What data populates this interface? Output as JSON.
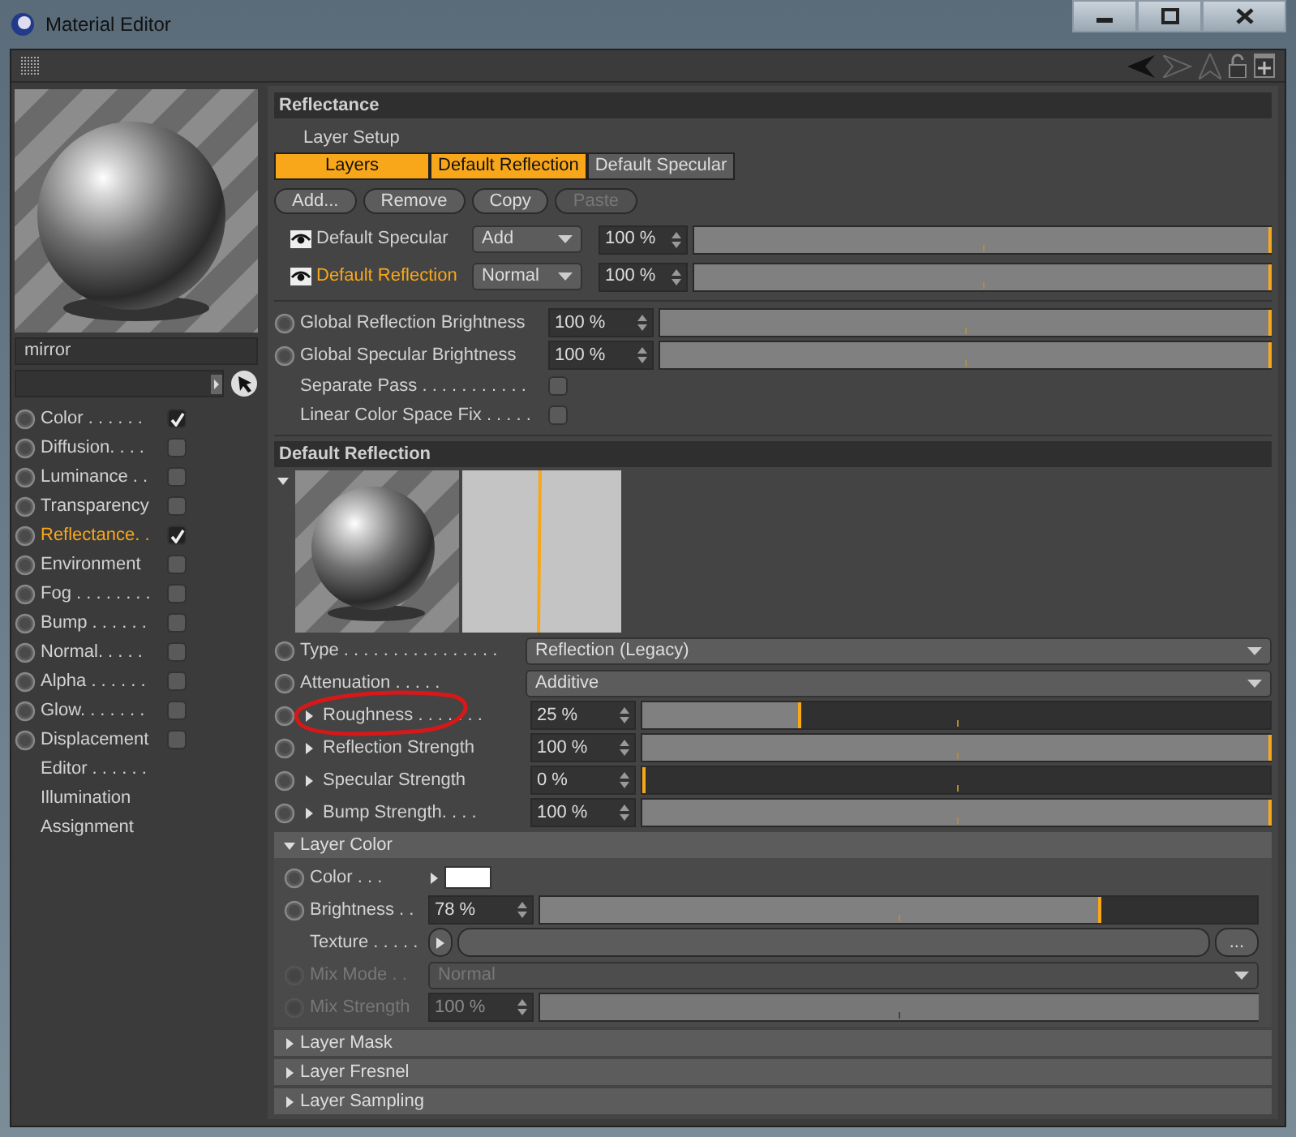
{
  "window": {
    "title": "Material Editor"
  },
  "material": {
    "name": "mirror"
  },
  "channels": [
    {
      "label": "Color . . . . . .",
      "kind": "channel",
      "checked": true,
      "selected": false
    },
    {
      "label": "Diffusion. . . .",
      "kind": "channel",
      "checked": false,
      "selected": false
    },
    {
      "label": "Luminance . .",
      "kind": "channel",
      "checked": false,
      "selected": false
    },
    {
      "label": "Transparency",
      "kind": "channel",
      "checked": false,
      "selected": false
    },
    {
      "label": "Reflectance. .",
      "kind": "channel",
      "checked": true,
      "selected": true
    },
    {
      "label": "Environment",
      "kind": "channel",
      "checked": false,
      "selected": false
    },
    {
      "label": "Fog . . . . . . . .",
      "kind": "channel",
      "checked": false,
      "selected": false
    },
    {
      "label": "Bump . . . . . .",
      "kind": "channel",
      "checked": false,
      "selected": false
    },
    {
      "label": "Normal. . . . .",
      "kind": "channel",
      "checked": false,
      "selected": false
    },
    {
      "label": "Alpha . . . . . .",
      "kind": "channel",
      "checked": false,
      "selected": false
    },
    {
      "label": "Glow. . . . . . .",
      "kind": "channel",
      "checked": false,
      "selected": false
    },
    {
      "label": "Displacement",
      "kind": "channel",
      "checked": false,
      "selected": false
    },
    {
      "label": "Editor . . . . . .",
      "kind": "page",
      "selected": false
    },
    {
      "label": "Illumination",
      "kind": "page",
      "selected": false
    },
    {
      "label": "Assignment",
      "kind": "page",
      "selected": false
    }
  ],
  "reflectance": {
    "title": "Reflectance",
    "layer_setup": "Layer Setup",
    "tabs": [
      {
        "label": "Layers",
        "selected": true
      },
      {
        "label": "Default Reflection",
        "selected": true
      },
      {
        "label": "Default Specular",
        "selected": false
      }
    ],
    "buttons": [
      {
        "label": "Add...",
        "disabled": false
      },
      {
        "label": "Remove",
        "disabled": false
      },
      {
        "label": "Copy",
        "disabled": false
      },
      {
        "label": "Paste",
        "disabled": true
      }
    ],
    "layers": [
      {
        "name": "Default Specular",
        "mode": "Add",
        "value": "100 %",
        "level": 1,
        "active": false
      },
      {
        "name": "Default Reflection",
        "mode": "Normal",
        "value": "100 %",
        "level": 1,
        "active": true
      }
    ],
    "globals": [
      {
        "label": "Global Reflection Brightness",
        "value": "100 %",
        "level": 1
      },
      {
        "label": "Global Specular Brightness",
        "value": "100 %",
        "level": 1
      }
    ],
    "options": [
      {
        "label": "Separate Pass . . . . . . . . . . .",
        "checked": false
      },
      {
        "label": "Linear Color Space Fix . . . . .",
        "checked": false
      }
    ]
  },
  "layer": {
    "title": "Default Reflection",
    "params": [
      {
        "kind": "dropdown",
        "label": "Type . . . . . . . . . . . . . . . .",
        "value": "Reflection (Legacy)"
      },
      {
        "kind": "dropdown",
        "label": "Attenuation . . . . .",
        "value": "Additive"
      },
      {
        "kind": "slider",
        "label": "Roughness . . . . . . .",
        "value": "25 %",
        "level": 0.25
      },
      {
        "kind": "slider",
        "label": "Reflection Strength",
        "value": "100 %",
        "level": 1
      },
      {
        "kind": "slider",
        "label": "Specular Strength",
        "value": "0 %",
        "level": 0
      },
      {
        "kind": "slider",
        "label": "Bump Strength. . . .",
        "value": "100 %",
        "level": 1
      }
    ]
  },
  "groups": [
    {
      "title": "Layer Color",
      "expanded": true,
      "params": [
        {
          "kind": "color",
          "label": "Color . . .",
          "color": "#ffffff",
          "disabled": false
        },
        {
          "kind": "slider",
          "label": "Brightness . .",
          "value": "78 %",
          "level": 0.78,
          "disabled": false
        },
        {
          "kind": "texture",
          "label": "Texture . . . . .",
          "button": "...",
          "disabled": false
        },
        {
          "kind": "dropdown",
          "label": "Mix Mode . .",
          "value": "Normal",
          "disabled": true
        },
        {
          "kind": "slider",
          "label": "Mix Strength",
          "value": "100 %",
          "level": 1,
          "disabled": true
        }
      ]
    },
    {
      "title": "Layer Mask",
      "expanded": false
    },
    {
      "title": "Layer Fresnel",
      "expanded": false
    },
    {
      "title": "Layer Sampling",
      "expanded": false
    }
  ]
}
